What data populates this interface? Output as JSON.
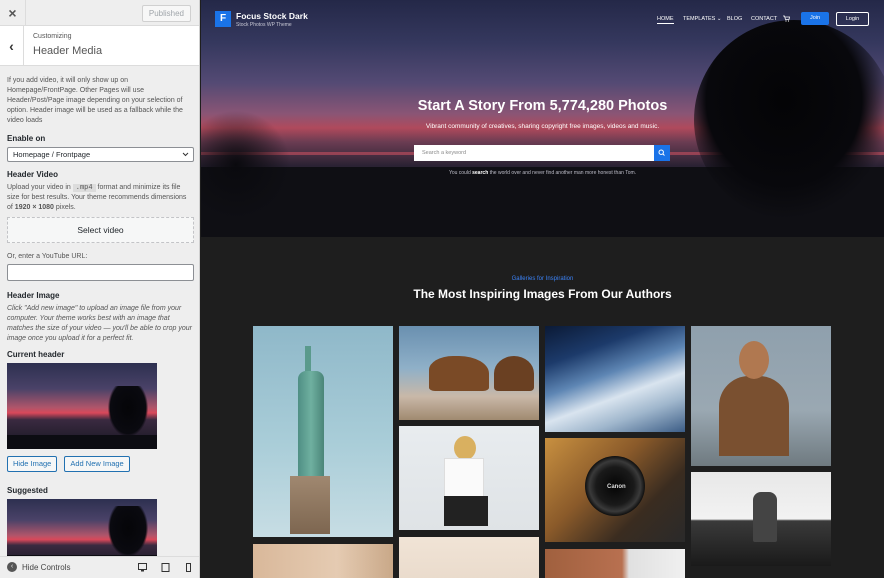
{
  "sidebar": {
    "close_glyph": "×",
    "published_label": "Published",
    "back_glyph": "‹",
    "customizing_label": "Customizing",
    "section_title": "Header Media",
    "intro_text": "If you add video, it will only show up on Homepage/FrontPage. Other Pages will use Header/Post/Page image depending on your selection of option. Header image will be used as a fallback while the video loads",
    "enable_on_label": "Enable on",
    "enable_on_value": "Homepage / Frontpage",
    "header_video_label": "Header Video",
    "video_desc_1": "Upload your video in",
    "video_format": ".mp4",
    "video_desc_2": "format and minimize its file size for best results. Your theme recommends dimensions of",
    "video_dims": "1920 × 1080",
    "video_desc_3": "pixels.",
    "select_video_label": "Select video",
    "youtube_label": "Or, enter a YouTube URL:",
    "youtube_value": "",
    "header_image_label": "Header Image",
    "header_image_desc": "Click \"Add new image\" to upload an image file from your computer. Your theme works best with an image that matches the size of your video — you'll be able to crop your image once you upload it for a perfect fit.",
    "current_header_label": "Current header",
    "hide_image_label": "Hide Image",
    "add_new_image_label": "Add New Image",
    "suggested_label": "Suggested",
    "hide_controls_label": "Hide Controls"
  },
  "preview": {
    "logo_letter": "F",
    "site_title": "Focus Stock Dark",
    "site_tagline": "Stock Photos WP Theme",
    "nav": [
      {
        "label": "HOME"
      },
      {
        "label": "TEMPLATES ⌄"
      },
      {
        "label": "BLOG"
      },
      {
        "label": "CONTACT"
      }
    ],
    "cart_glyph": "🛒",
    "join_label": "Join",
    "login_label": "Login",
    "hero_title": "Start A Story From 5,774,280 Photos",
    "hero_subtitle": "Vibrant community of creatives, sharing copyright free images, videos and music.",
    "search_placeholder": "Search a keyword",
    "hero_note_pre": "You could",
    "hero_note_bold": "search",
    "hero_note_post": "the world over and never find another man more honest than Tom.",
    "section_kicker": "Galleries for Inspiration",
    "section_title": "The Most Inspiring Images From Our Authors",
    "camera_brand": "Canon"
  },
  "colors": {
    "accent": "#1a73e8",
    "wp_link": "#2271b1",
    "kicker": "#3b82f6"
  }
}
